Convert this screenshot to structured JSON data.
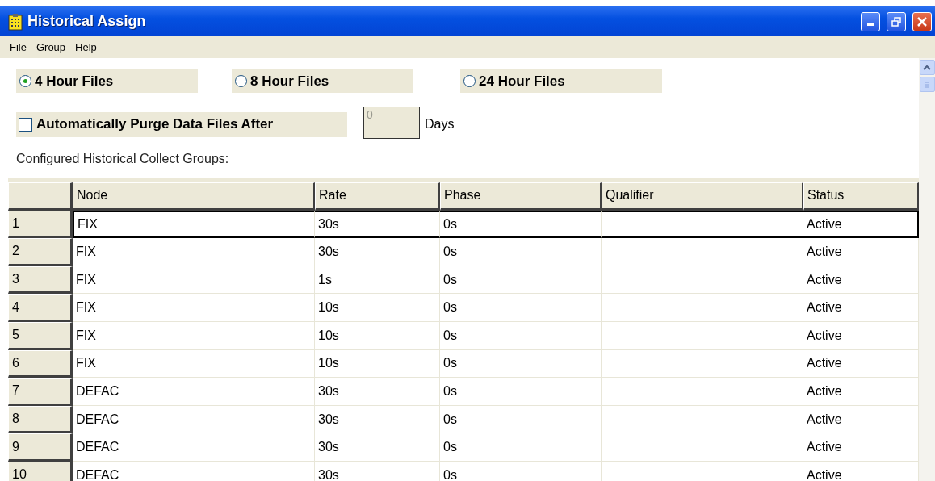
{
  "window": {
    "title": "Historical Assign"
  },
  "menu": [
    "File",
    "Group",
    "Help"
  ],
  "file_length": [
    {
      "label": "4 Hour Files",
      "selected": true
    },
    {
      "label": "8 Hour Files",
      "selected": false
    },
    {
      "label": "24 Hour Files",
      "selected": false
    }
  ],
  "purge": {
    "label": "Automatically Purge Data Files After",
    "checked": false,
    "value": "0",
    "unit": "Days"
  },
  "groups_label": "Configured Historical Collect Groups:",
  "table": {
    "columns": [
      "Node",
      "Rate",
      "Phase",
      "Qualifier",
      "Status"
    ],
    "rows": [
      {
        "number": "1",
        "cells": [
          "FIX",
          "30s",
          "0s",
          "",
          "Active"
        ],
        "selected": true
      },
      {
        "number": "2",
        "cells": [
          "FIX",
          "30s",
          "0s",
          "",
          "Active"
        ],
        "selected": false
      },
      {
        "number": "3",
        "cells": [
          "FIX",
          "1s",
          "0s",
          "",
          "Active"
        ],
        "selected": false
      },
      {
        "number": "4",
        "cells": [
          "FIX",
          "10s",
          "0s",
          "",
          "Active"
        ],
        "selected": false
      },
      {
        "number": "5",
        "cells": [
          "FIX",
          "10s",
          "0s",
          "",
          "Active"
        ],
        "selected": false
      },
      {
        "number": "6",
        "cells": [
          "FIX",
          "10s",
          "0s",
          "",
          "Active"
        ],
        "selected": false
      },
      {
        "number": "7",
        "cells": [
          "DEFAC",
          "30s",
          "0s",
          "",
          "Active"
        ],
        "selected": false
      },
      {
        "number": "8",
        "cells": [
          "DEFAC",
          "30s",
          "0s",
          "",
          "Active"
        ],
        "selected": false
      },
      {
        "number": "9",
        "cells": [
          "DEFAC",
          "30s",
          "0s",
          "",
          "Active"
        ],
        "selected": false
      },
      {
        "number": "10",
        "cells": [
          "DEFAC",
          "30s",
          "0s",
          "",
          "Active"
        ],
        "selected": false
      }
    ]
  }
}
